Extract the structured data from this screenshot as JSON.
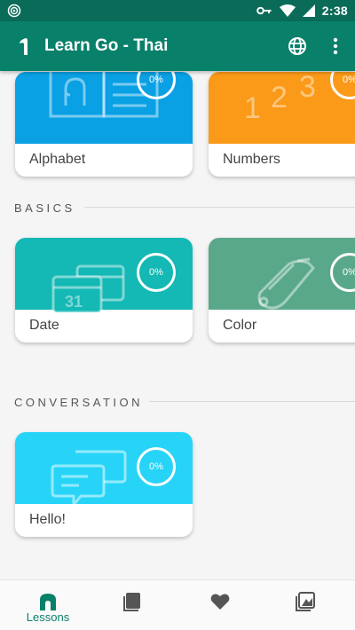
{
  "status_bar": {
    "time": "2:38"
  },
  "app_bar": {
    "title": "Learn Go - Thai"
  },
  "sections": [
    {
      "title": "BASICS"
    },
    {
      "title": "CONVERSATION"
    }
  ],
  "cards": [
    {
      "label": "Alphabet",
      "progress": "0%",
      "color": "#0aa0e4"
    },
    {
      "label": "Numbers",
      "progress": "0%",
      "color": "#fb9a18"
    },
    {
      "label": "Date",
      "progress": "0%",
      "color": "#14b8b4"
    },
    {
      "label": "Color",
      "progress": "0%",
      "color": "#5aa88a"
    },
    {
      "label": "Hello!",
      "progress": "0%",
      "color": "#27d4f8"
    }
  ],
  "numbers_art": [
    "1",
    "2",
    "3"
  ],
  "date_art": "31",
  "bottom_nav": [
    {
      "label": "Lessons",
      "icon": "lessons-icon",
      "active": true
    },
    {
      "label": "",
      "icon": "book-icon"
    },
    {
      "label": "",
      "icon": "heart-icon"
    },
    {
      "label": "",
      "icon": "flashcard-icon"
    }
  ],
  "colors": {
    "primary": "#08806a",
    "status_bar": "#0a6b59",
    "inactive_icon": "#555555"
  }
}
